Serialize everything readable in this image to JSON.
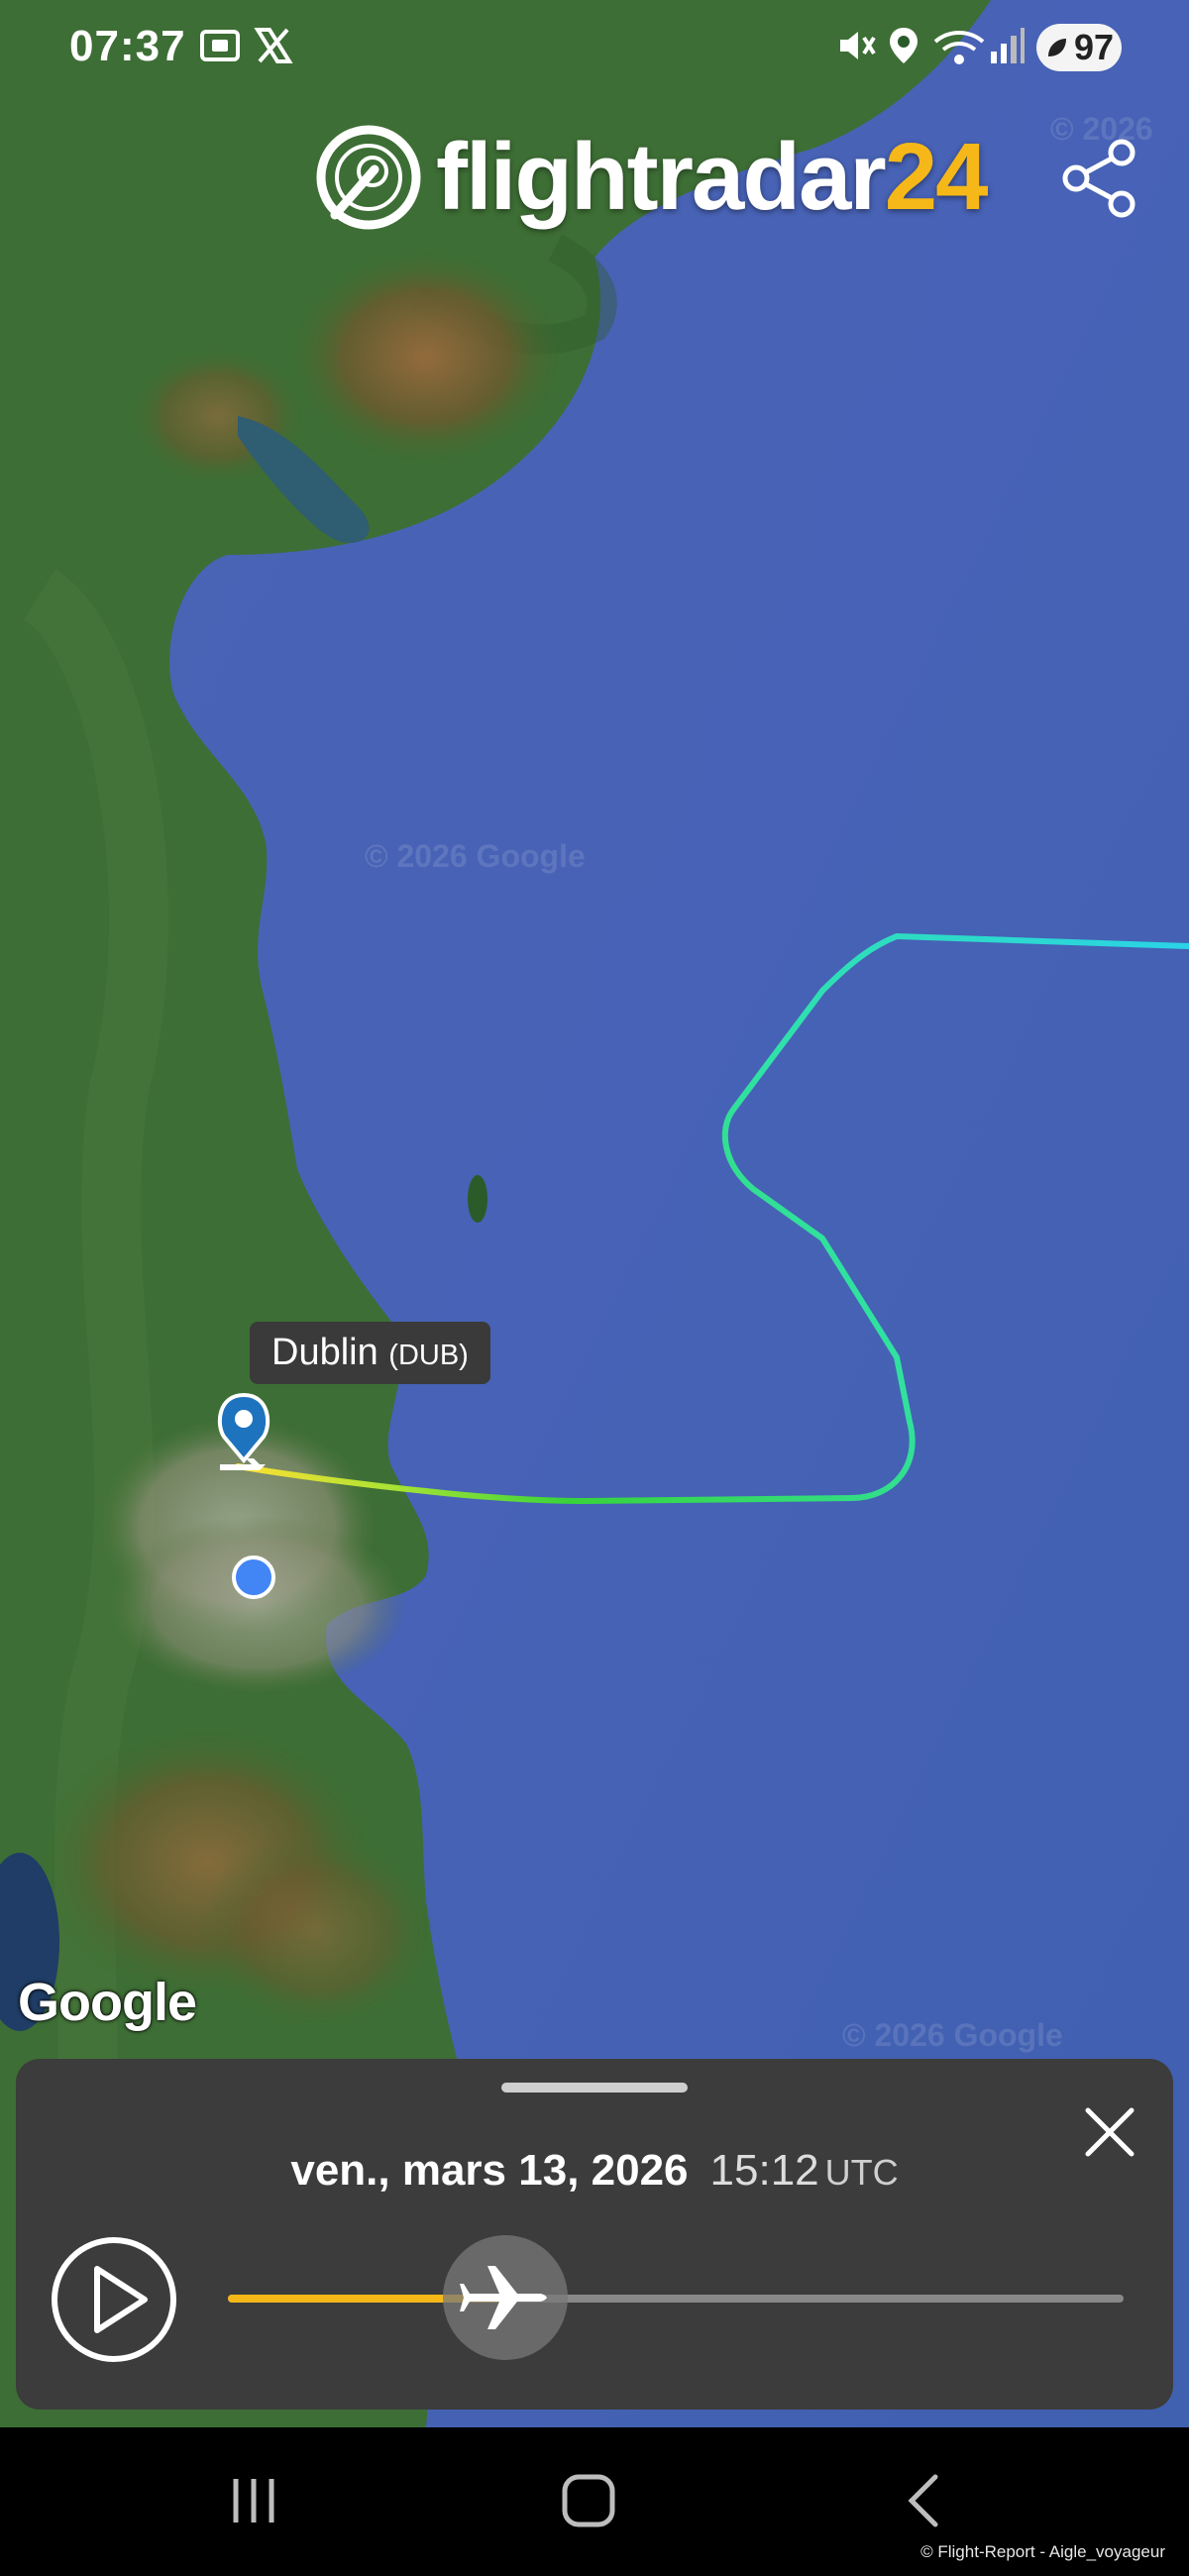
{
  "status_bar": {
    "time": "07:37",
    "battery": "97",
    "icons": [
      "screenshot-icon",
      "x-app-icon",
      "mute-icon",
      "location-icon",
      "wifi-icon",
      "signal-icon",
      "battery-saver-icon"
    ]
  },
  "header": {
    "brand_prefix": "flightradar",
    "brand_suffix": "24",
    "share_icon": "share-icon"
  },
  "map": {
    "watermarks": [
      "© 2026 Google",
      "© 2026 Google",
      "© 2026",
      "© 2026 Google"
    ],
    "airport": {
      "name": "Dublin",
      "code": "(DUB)"
    },
    "attribution": "Google",
    "track_colors": [
      "#ffe032",
      "#38d43a",
      "#30e2a6",
      "#2ad3e8"
    ]
  },
  "playback": {
    "date": "ven., mars 13, 2026",
    "time": "15:12",
    "timezone": "UTC",
    "progress_pct": 31,
    "accent": "#f6b818"
  },
  "navbar": {
    "buttons": [
      "recent-apps-icon",
      "home-icon",
      "back-icon"
    ]
  },
  "footer": {
    "copyright": "© Flight-Report - Aigle_voyageur"
  }
}
